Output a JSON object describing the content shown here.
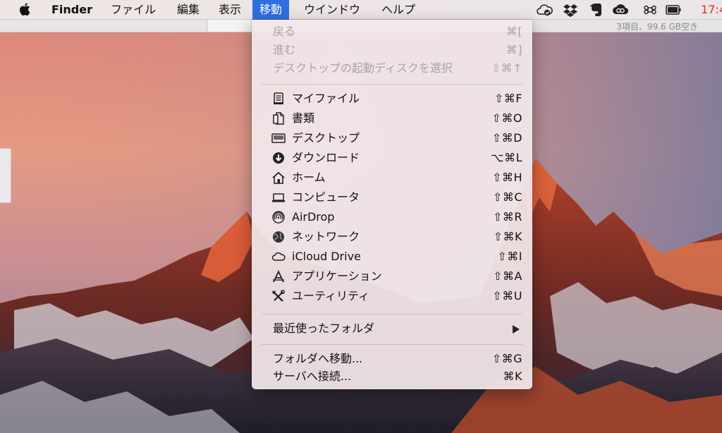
{
  "menubar": {
    "app_name": "Finder",
    "items": [
      "ファイル",
      "編集",
      "表示",
      "移動",
      "ウインドウ",
      "ヘルプ"
    ],
    "active_item": "移動",
    "clock": "17:4",
    "status_icons": [
      "cloud-check-icon",
      "dropbox-icon",
      "evernote-icon",
      "creative-cloud-icon",
      "command-icon",
      "battery-icon"
    ]
  },
  "window_behind": {
    "status_text": "3項目、99.6 GB空き"
  },
  "go_menu": {
    "history": [
      {
        "label": "戻る",
        "shortcut": "⌘[",
        "enabled": false
      },
      {
        "label": "進む",
        "shortcut": "⌘]",
        "enabled": false
      },
      {
        "label": "デスクトップの起動ディスクを選択",
        "shortcut": "⇧⌘↑",
        "enabled": false
      }
    ],
    "places": [
      {
        "label": "マイファイル",
        "shortcut": "⇧⌘F",
        "icon": "all-my-files-icon"
      },
      {
        "label": "書類",
        "shortcut": "⇧⌘O",
        "icon": "documents-icon"
      },
      {
        "label": "デスクトップ",
        "shortcut": "⇧⌘D",
        "icon": "desktop-icon"
      },
      {
        "label": "ダウンロード",
        "shortcut": "⌥⌘L",
        "icon": "downloads-icon"
      },
      {
        "label": "ホーム",
        "shortcut": "⇧⌘H",
        "icon": "home-icon"
      },
      {
        "label": "コンピュータ",
        "shortcut": "⇧⌘C",
        "icon": "computer-icon"
      },
      {
        "label": "AirDrop",
        "shortcut": "⇧⌘R",
        "icon": "airdrop-icon"
      },
      {
        "label": "ネットワーク",
        "shortcut": "⇧⌘K",
        "icon": "network-icon"
      },
      {
        "label": "iCloud Drive",
        "shortcut": "⇧⌘I",
        "icon": "icloud-icon"
      },
      {
        "label": "アプリケーション",
        "shortcut": "⇧⌘A",
        "icon": "applications-icon"
      },
      {
        "label": "ユーティリティ",
        "shortcut": "⇧⌘U",
        "icon": "utilities-icon"
      }
    ],
    "recent_folders": {
      "label": "最近使ったフォルダ"
    },
    "go_to_folder": {
      "label": "フォルダへ移動...",
      "shortcut": "⇧⌘G"
    },
    "connect_server": {
      "label": "サーバへ接続...",
      "shortcut": "⌘K"
    }
  },
  "colors": {
    "menu_highlight": "#2e6fe0",
    "clock": "#e0311e"
  }
}
